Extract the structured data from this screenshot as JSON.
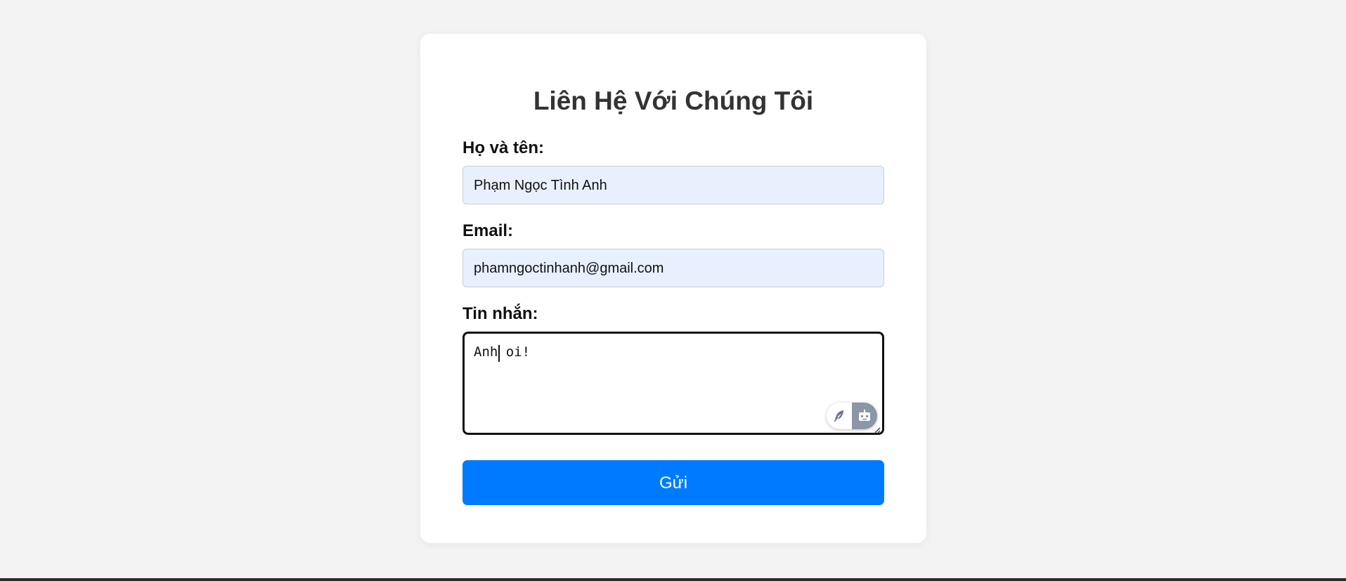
{
  "form": {
    "title": "Liên Hệ Với Chúng Tôi",
    "name_label": "Họ và tên:",
    "name_value": "Phạm Ngọc Tình Anh",
    "email_label": "Email:",
    "email_value": "phamngoctinhanh@gmail.com",
    "message_label": "Tin nhắn:",
    "message_value": "Anh oi!",
    "submit_label": "Gửi"
  },
  "widgets": {
    "assist_left_icon": "feather-icon",
    "assist_right_icon": "robot-icon"
  },
  "colors": {
    "accent": "#007bff",
    "input_fill": "#e8f0fd",
    "page_bg": "#f3f3f3"
  }
}
